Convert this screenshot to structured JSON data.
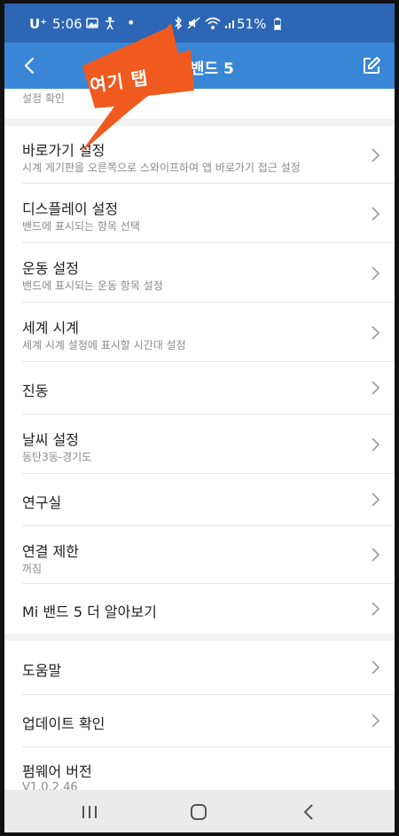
{
  "status_bar": {
    "carrier": "U⁺",
    "time": "5:06",
    "battery": "51%"
  },
  "app_bar": {
    "title": "Mi 밴드 5"
  },
  "clipped_row": {
    "sub": "설정 확인"
  },
  "settings": {
    "section1": [
      {
        "title": "바로가기 설정",
        "subtitle": "시계 게기판을 오른쪽으로 스와이프하여 앱 바로가기 접근 설정"
      },
      {
        "title": "디스플레이 설정",
        "subtitle": "밴드에 표시되는 항목 선택"
      },
      {
        "title": "운동 설정",
        "subtitle": "밴드에 표시되는 운동 항목 설정"
      },
      {
        "title": "세계 시계",
        "subtitle": "세계 시계 설정에 표시할 시간대 설정"
      },
      {
        "title": "진동"
      },
      {
        "title": "날씨 설정",
        "subtitle": "동탄3동-경기도"
      },
      {
        "title": "연구실"
      },
      {
        "title": "연결 제한",
        "subtitle": "꺼짐"
      },
      {
        "title": "Mi 밴드 5 더 알아보기"
      }
    ],
    "section2": [
      {
        "title": "도움말"
      },
      {
        "title": "업데이트 확인"
      },
      {
        "title": "펌웨어 버전",
        "subtitle": "V1.0.2.46"
      }
    ]
  },
  "callout": {
    "text": "여기 탭",
    "color": "#f05a1e"
  },
  "colors": {
    "status_bar": "#2d66b5",
    "app_bar": "#3a86d6"
  }
}
